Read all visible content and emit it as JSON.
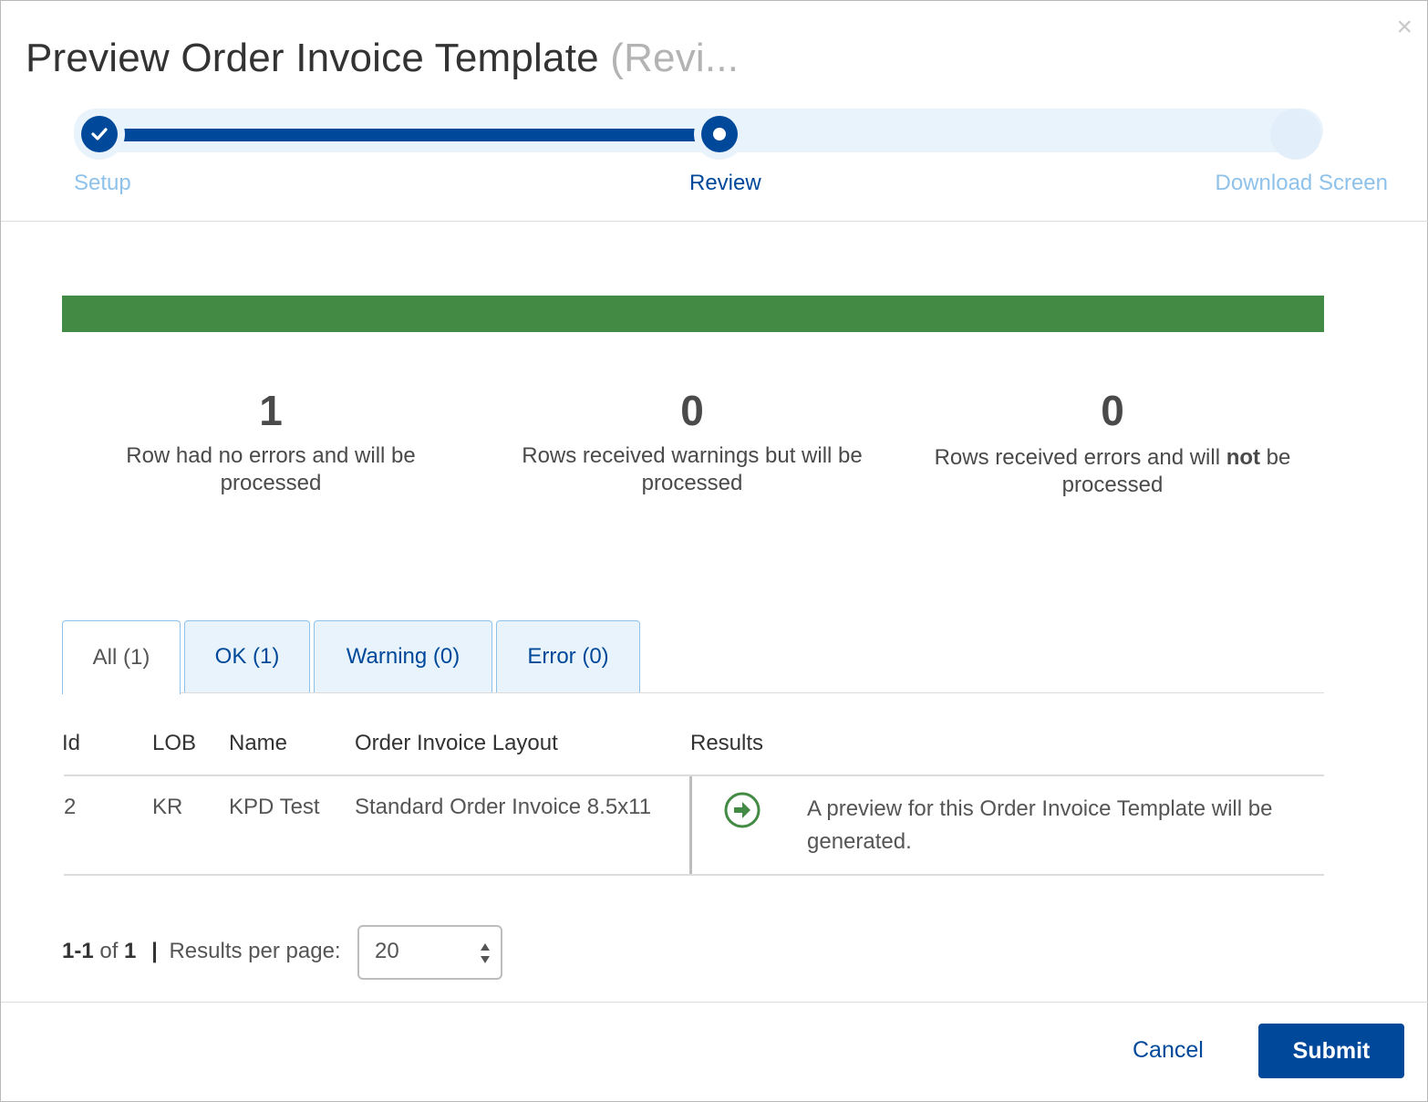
{
  "dialog": {
    "title": "Preview Order Invoice Template",
    "title_sub": "(Revi...",
    "close_glyph": "×"
  },
  "stepper": {
    "steps": [
      {
        "label": "Setup",
        "state": "complete"
      },
      {
        "label": "Review",
        "state": "active"
      },
      {
        "label": "Download Screen",
        "state": "pending"
      }
    ],
    "accent_color": "#00489a",
    "track_color": "#e8f3fc",
    "inactive_label_color": "#8ec2ea"
  },
  "progress": {
    "percent": 100,
    "color": "#438a45"
  },
  "summary": {
    "ok": {
      "count": "1",
      "text": "Row had no errors and will be processed"
    },
    "warning": {
      "count": "0",
      "text": "Rows received warnings but will be processed"
    },
    "error": {
      "count": "0",
      "text_before": "Rows received errors and will ",
      "text_bold": "not",
      "text_after": " be processed"
    }
  },
  "tabs": [
    {
      "label": "All (1)",
      "active": true
    },
    {
      "label": "OK (1)",
      "active": false
    },
    {
      "label": "Warning (0)",
      "active": false
    },
    {
      "label": "Error (0)",
      "active": false
    }
  ],
  "table": {
    "columns": [
      "Id",
      "LOB",
      "Name",
      "Order Invoice Layout",
      "Results"
    ],
    "rows": [
      {
        "id": "2",
        "lob": "KR",
        "name": "KPD Test",
        "layout": "Standard Order Invoice 8.5x11",
        "result_icon": "arrow-right-circle-icon",
        "result_text": "A preview for this Order Invoice Template will be generated."
      }
    ]
  },
  "pagination": {
    "range": "1-1",
    "of_label": "of",
    "total": "1",
    "separator": "|",
    "per_page_label": "Results per page:",
    "per_page_value": "20"
  },
  "footer": {
    "cancel_label": "Cancel",
    "submit_label": "Submit"
  }
}
